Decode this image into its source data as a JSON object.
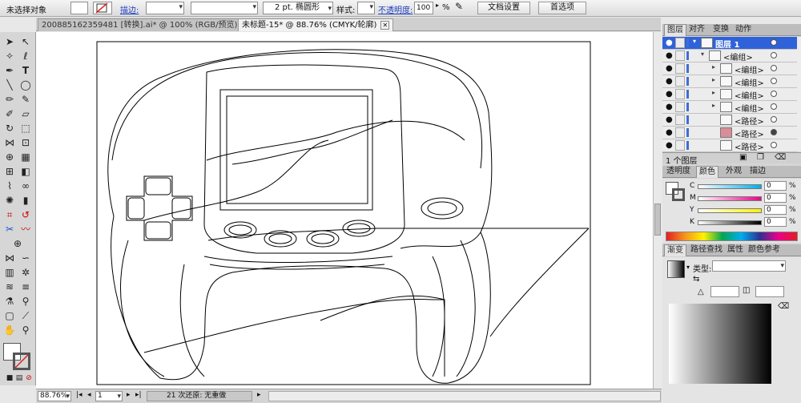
{
  "control_bar": {
    "selection_status": "未选择对象",
    "stroke_label": "描边:",
    "stroke_weight_value": "",
    "brush_value": "2 pt. 椭圆形",
    "style_label": "样式:",
    "opacity_label": "不透明度:",
    "opacity_value": "100",
    "opacity_unit": "%",
    "doc_setup_button": "文档设置",
    "preferences_button": "首选项"
  },
  "tabs": [
    {
      "label": "200885162359481 [转换].ai* @ 100% (RGB/预览)"
    },
    {
      "label": "未标题-15* @ 88.76% (CMYK/轮廓)"
    }
  ],
  "status_bar": {
    "zoom": "88.76%",
    "page": "1",
    "undo_status": "21 次还原: 无重做"
  },
  "layers_panel": {
    "tabs": [
      "图层",
      "对齐",
      "变换",
      "动作"
    ],
    "rows": [
      {
        "name": "图层 1",
        "level": 0
      },
      {
        "name": "<编组>",
        "level": 1
      },
      {
        "name": "<编组>",
        "level": 2
      },
      {
        "name": "<编组>",
        "level": 2
      },
      {
        "name": "<编组>",
        "level": 2
      },
      {
        "name": "<编组>",
        "level": 2
      },
      {
        "name": "<路径>",
        "level": 2
      },
      {
        "name": "<路径>",
        "level": 2
      },
      {
        "name": "<路径>",
        "level": 2
      }
    ],
    "footer": "1 个图层"
  },
  "color_panel": {
    "tabs": [
      "透明度",
      "颜色",
      "外观",
      "描边"
    ],
    "channels": [
      {
        "label": "C",
        "value": "0",
        "unit": "%"
      },
      {
        "label": "M",
        "value": "0",
        "unit": "%"
      },
      {
        "label": "Y",
        "value": "0",
        "unit": "%"
      },
      {
        "label": "K",
        "value": "0",
        "unit": "%"
      }
    ]
  },
  "gradient_panel": {
    "tabs": [
      "渐变",
      "路径查找",
      "属性",
      "颜色参考"
    ],
    "type_label": "类型:"
  },
  "colors": {
    "selection_blue": "#2f62d9",
    "layer_color": "#3e6ed8"
  }
}
